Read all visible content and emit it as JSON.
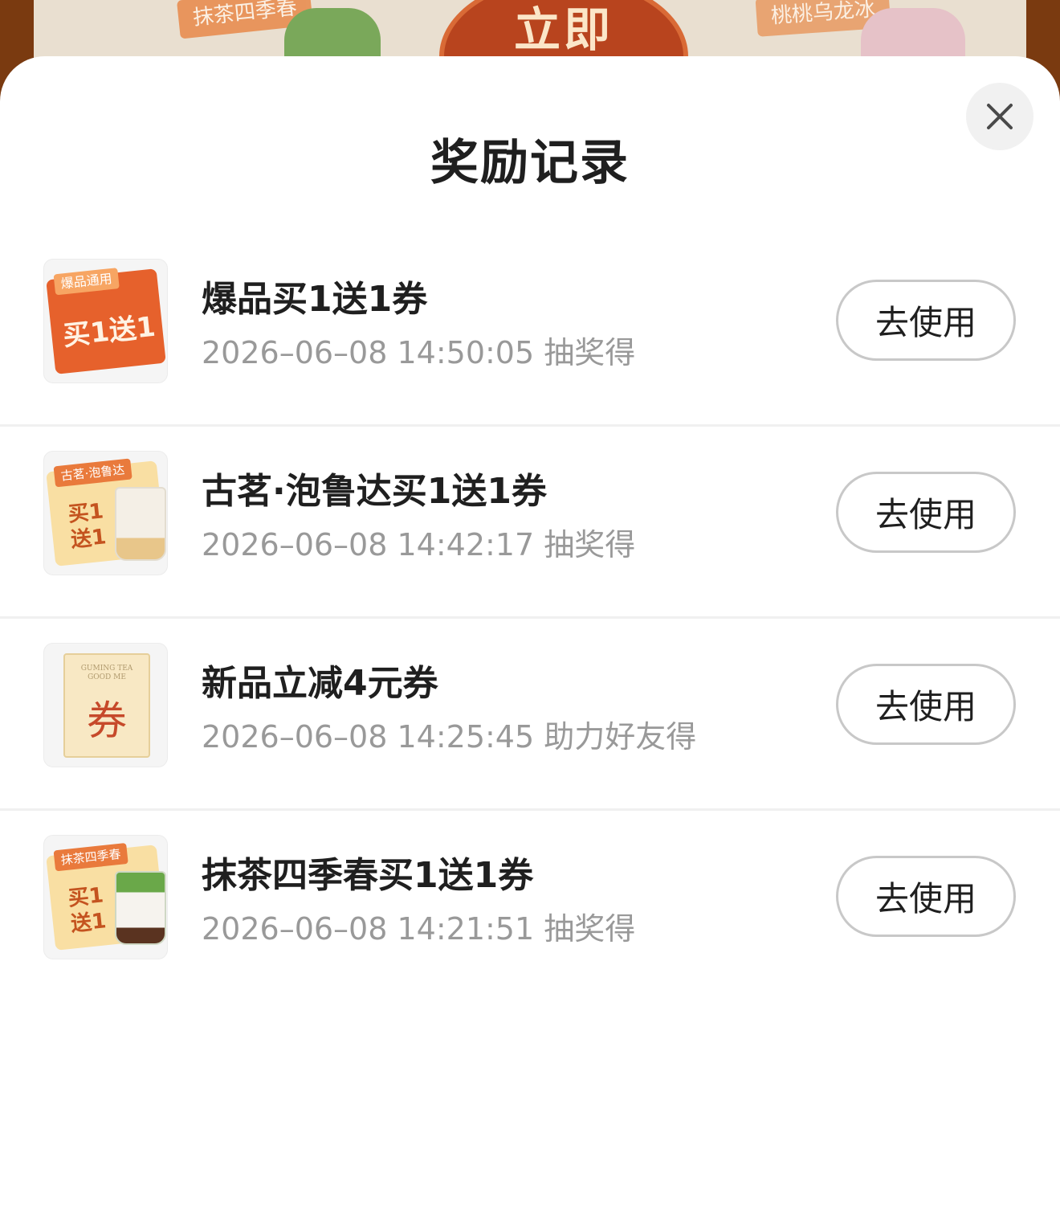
{
  "background": {
    "left_tag": "抹茶四季春",
    "right_tag": "桃桃乌龙冰",
    "cta": "立即"
  },
  "sheet": {
    "title": "奖励记录",
    "close_icon": "close-icon"
  },
  "records": [
    {
      "name": "爆品买1送1券",
      "meta": "2026–06–08 14:50:05 抽奖得",
      "button": "去使用",
      "thumb": {
        "tag": "爆品通用",
        "text": "买1送1"
      }
    },
    {
      "name": "古茗·泡鲁达买1送1券",
      "meta": "2026–06–08 14:42:17 抽奖得",
      "button": "去使用",
      "thumb": {
        "tag": "古茗·泡鲁达",
        "line1": "买1",
        "line2": "送1"
      }
    },
    {
      "name": "新品立减4元券",
      "meta": "2026–06–08 14:25:45 助力好友得",
      "button": "去使用",
      "thumb": {
        "line1": "GUMING TEA",
        "line2": "GOOD ME",
        "char": "券"
      }
    },
    {
      "name": "抹茶四季春买1送1券",
      "meta": "2026–06–08 14:21:51 抽奖得",
      "button": "去使用",
      "thumb": {
        "tag": "抹茶四季春",
        "line1": "买1",
        "line2": "送1"
      }
    }
  ]
}
